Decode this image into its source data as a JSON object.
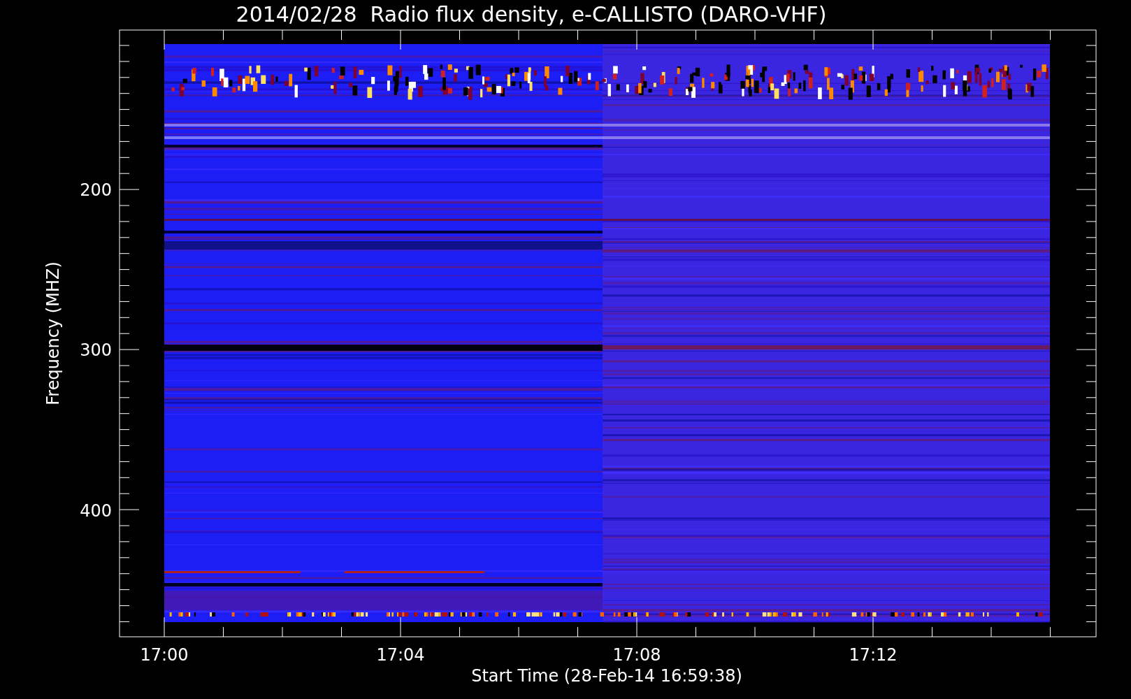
{
  "title": "2014/02/28  Radio flux density, e-CALLISTO (DARO-VHF)",
  "y_axis": {
    "label": "Frequency (MHZ)",
    "ticks": [
      "200",
      "300",
      "400"
    ]
  },
  "x_axis": {
    "label": "Start Time (28-Feb-14 16:59:38)",
    "ticks": [
      "17:00",
      "17:04",
      "17:08",
      "17:12"
    ]
  }
}
